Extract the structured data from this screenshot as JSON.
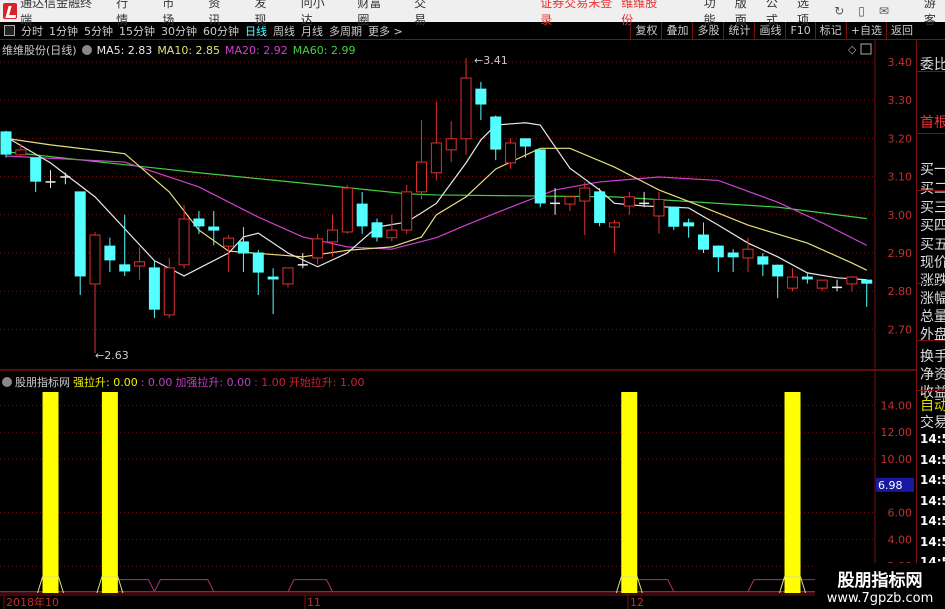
{
  "menubar": {
    "app_title": "通达信金融终端",
    "items": [
      "行情",
      "市场",
      "资讯",
      "发现",
      "问小达",
      "财富圈",
      "交易"
    ],
    "status": "证券交易未登录",
    "stock": "维维股份",
    "right_items": [
      "功能",
      "版面",
      "公式",
      "选项"
    ],
    "user": "游客"
  },
  "toolbar": {
    "periods": [
      "分时",
      "1分钟",
      "5分钟",
      "15分钟",
      "30分钟",
      "60分钟",
      "日线",
      "周线",
      "月线",
      "多周期",
      "更多 >"
    ],
    "active": "日线",
    "right": [
      "复权",
      "叠加",
      "多股",
      "统计",
      "画线",
      "F10",
      "标记",
      "+自选",
      "返回"
    ]
  },
  "main": {
    "title": "维维股份(日线)",
    "ma": [
      {
        "label": "MA5: 2.83",
        "color": "#e8e8e8"
      },
      {
        "label": "MA10: 2.85",
        "color": "#e6e07a"
      },
      {
        "label": "MA20: 2.92",
        "color": "#d040d0"
      },
      {
        "label": "MA60: 2.99",
        "color": "#40d040"
      }
    ],
    "high_label": "3.41",
    "low_label": "2.63"
  },
  "indicator": {
    "name": "股朋指标网",
    "parts": [
      {
        "label": "强拉升: 0.00",
        "color": "#f0f000"
      },
      {
        "label": ": 0.00",
        "color": "#c040c0"
      },
      {
        "label": "加强拉升: 0.00",
        "color": "#c040c0"
      },
      {
        "label": ": 1.00",
        "color": "#d02030"
      },
      {
        "label": "开始拉升: 1.00",
        "color": "#d02030"
      }
    ],
    "current": "6.98"
  },
  "time_axis": [
    "2018年10",
    "11",
    "12"
  ],
  "colors": {
    "up": "#e03030",
    "down": "#54ffff",
    "grid": "#7a1010",
    "bar": "#ffff00"
  },
  "chart_data": {
    "type": "candlestick",
    "price_ticks": [
      3.4,
      3.3,
      3.2,
      3.1,
      3.0,
      2.9,
      2.8,
      2.7
    ],
    "ind_ticks": [
      14.0,
      12.0,
      10.0,
      6.0,
      4.0,
      2.0
    ],
    "ohlc": [
      [
        3.217,
        3.22,
        3.15,
        3.159
      ],
      [
        3.157,
        3.185,
        3.151,
        3.17
      ],
      [
        3.149,
        3.15,
        3.06,
        3.088
      ],
      [
        3.086,
        3.117,
        3.07,
        3.086
      ],
      [
        3.099,
        3.11,
        3.08,
        3.099
      ],
      [
        3.06,
        3.06,
        2.79,
        2.84
      ],
      [
        2.819,
        2.955,
        2.638,
        2.947
      ],
      [
        2.918,
        2.94,
        2.85,
        2.882
      ],
      [
        2.869,
        3.0,
        2.84,
        2.853
      ],
      [
        2.866,
        2.915,
        2.83,
        2.877
      ],
      [
        2.861,
        2.88,
        2.73,
        2.753
      ],
      [
        2.738,
        2.887,
        2.73,
        2.861
      ],
      [
        2.869,
        3.026,
        2.86,
        2.989
      ],
      [
        2.989,
        3.01,
        2.95,
        2.971
      ],
      [
        2.968,
        3.01,
        2.92,
        2.96
      ],
      [
        2.918,
        2.947,
        2.85,
        2.939
      ],
      [
        2.929,
        2.968,
        2.85,
        2.9
      ],
      [
        2.9,
        2.908,
        2.79,
        2.85
      ],
      [
        2.837,
        2.86,
        2.74,
        2.832
      ],
      [
        2.819,
        2.861,
        2.81,
        2.861
      ],
      [
        2.869,
        2.9,
        2.86,
        2.869
      ],
      [
        2.887,
        2.95,
        2.87,
        2.937
      ],
      [
        2.929,
        3.0,
        2.89,
        2.96
      ],
      [
        2.955,
        3.078,
        2.95,
        3.07
      ],
      [
        3.028,
        3.06,
        2.95,
        2.971
      ],
      [
        2.979,
        2.99,
        2.93,
        2.942
      ],
      [
        2.94,
        3.0,
        2.93,
        2.96
      ],
      [
        2.96,
        3.078,
        2.95,
        3.06
      ],
      [
        3.06,
        3.248,
        3.04,
        3.138
      ],
      [
        3.11,
        3.295,
        3.09,
        3.188
      ],
      [
        3.17,
        3.245,
        3.138,
        3.199
      ],
      [
        3.199,
        3.41,
        3.157,
        3.358
      ],
      [
        3.329,
        3.348,
        3.248,
        3.29
      ],
      [
        3.256,
        3.26,
        3.143,
        3.172
      ],
      [
        3.136,
        3.2,
        3.12,
        3.188
      ],
      [
        3.199,
        3.2,
        3.15,
        3.18
      ],
      [
        3.17,
        3.17,
        3.02,
        3.031
      ],
      [
        3.03,
        3.07,
        3.0,
        3.03
      ],
      [
        3.028,
        3.05,
        3.01,
        3.047
      ],
      [
        3.036,
        3.086,
        2.947,
        3.07
      ],
      [
        3.06,
        3.07,
        2.97,
        2.98
      ],
      [
        2.968,
        2.987,
        2.9,
        2.979
      ],
      [
        3.023,
        3.06,
        3.0,
        3.047
      ],
      [
        3.03,
        3.06,
        3.02,
        3.03
      ],
      [
        2.997,
        3.06,
        2.95,
        3.04
      ],
      [
        3.02,
        3.02,
        2.96,
        2.97
      ],
      [
        2.979,
        2.99,
        2.94,
        2.971
      ],
      [
        2.947,
        2.98,
        2.9,
        2.91
      ],
      [
        2.918,
        2.92,
        2.85,
        2.89
      ],
      [
        2.9,
        2.91,
        2.85,
        2.89
      ],
      [
        2.887,
        2.94,
        2.85,
        2.91
      ],
      [
        2.89,
        2.9,
        2.84,
        2.871
      ],
      [
        2.868,
        2.87,
        2.782,
        2.84
      ],
      [
        2.808,
        2.86,
        2.8,
        2.837
      ],
      [
        2.837,
        2.85,
        2.82,
        2.832
      ],
      [
        2.808,
        2.83,
        2.8,
        2.829
      ],
      [
        2.81,
        2.83,
        2.8,
        2.81
      ],
      [
        2.819,
        2.84,
        2.8,
        2.837
      ],
      [
        2.829,
        2.83,
        2.759,
        2.821
      ]
    ],
    "ma5": [
      [
        0,
        3.204
      ],
      [
        3,
        3.136
      ],
      [
        6,
        3.047
      ],
      [
        10,
        2.88
      ],
      [
        12,
        2.84
      ],
      [
        15,
        2.9
      ],
      [
        16,
        2.942
      ],
      [
        17,
        2.952
      ],
      [
        19,
        2.9
      ],
      [
        21,
        2.864
      ],
      [
        23,
        2.9
      ],
      [
        25,
        2.968
      ],
      [
        27,
        2.981
      ],
      [
        28,
        3.005
      ],
      [
        29,
        3.03
      ],
      [
        30,
        3.083
      ],
      [
        31,
        3.136
      ],
      [
        32,
        3.196
      ],
      [
        33,
        3.235
      ],
      [
        35,
        3.241
      ],
      [
        36,
        3.235
      ],
      [
        37,
        3.178
      ],
      [
        38,
        3.122
      ],
      [
        40,
        3.065
      ],
      [
        41,
        3.03
      ],
      [
        43,
        3.023
      ],
      [
        46,
        3.018
      ],
      [
        48,
        2.973
      ],
      [
        50,
        2.926
      ],
      [
        52,
        2.89
      ],
      [
        54,
        2.848
      ],
      [
        56,
        2.835
      ],
      [
        58,
        2.83
      ]
    ],
    "ma10": [
      [
        0,
        3.2
      ],
      [
        3,
        3.183
      ],
      [
        8,
        3.16
      ],
      [
        11,
        3.06
      ],
      [
        13,
        2.96
      ],
      [
        15,
        2.905
      ],
      [
        20,
        2.89
      ],
      [
        23,
        2.907
      ],
      [
        26,
        2.916
      ],
      [
        28,
        2.942
      ],
      [
        29,
        3.0
      ],
      [
        31,
        3.047
      ],
      [
        33,
        3.12
      ],
      [
        36,
        3.174
      ],
      [
        38,
        3.174
      ],
      [
        41,
        3.125
      ],
      [
        44,
        3.065
      ],
      [
        47,
        3.02
      ],
      [
        50,
        2.973
      ],
      [
        54,
        2.926
      ],
      [
        57,
        2.874
      ],
      [
        58,
        2.855
      ]
    ],
    "ma20": [
      [
        0,
        3.154
      ],
      [
        8,
        3.138
      ],
      [
        13,
        3.073
      ],
      [
        17,
        2.994
      ],
      [
        20,
        2.942
      ],
      [
        23,
        2.916
      ],
      [
        26,
        2.91
      ],
      [
        29,
        2.94
      ],
      [
        31,
        2.973
      ],
      [
        34,
        3.02
      ],
      [
        37,
        3.065
      ],
      [
        40,
        3.086
      ],
      [
        44,
        3.099
      ],
      [
        48,
        3.09
      ],
      [
        52,
        3.033
      ],
      [
        55,
        2.979
      ],
      [
        58,
        2.92
      ]
    ],
    "ma60": [
      [
        0,
        3.165
      ],
      [
        13,
        3.11
      ],
      [
        20,
        3.083
      ],
      [
        27,
        3.055
      ],
      [
        29,
        3.052
      ],
      [
        41,
        3.047
      ],
      [
        52,
        3.02
      ],
      [
        58,
        2.99
      ]
    ],
    "signal_bars": [
      3,
      7,
      42,
      53
    ],
    "signal_bar_value": 15,
    "pulses": [
      [
        7,
        10
      ],
      [
        10,
        14
      ],
      [
        19,
        22
      ],
      [
        42,
        45
      ],
      [
        50,
        53
      ],
      [
        53,
        56
      ]
    ]
  }
}
